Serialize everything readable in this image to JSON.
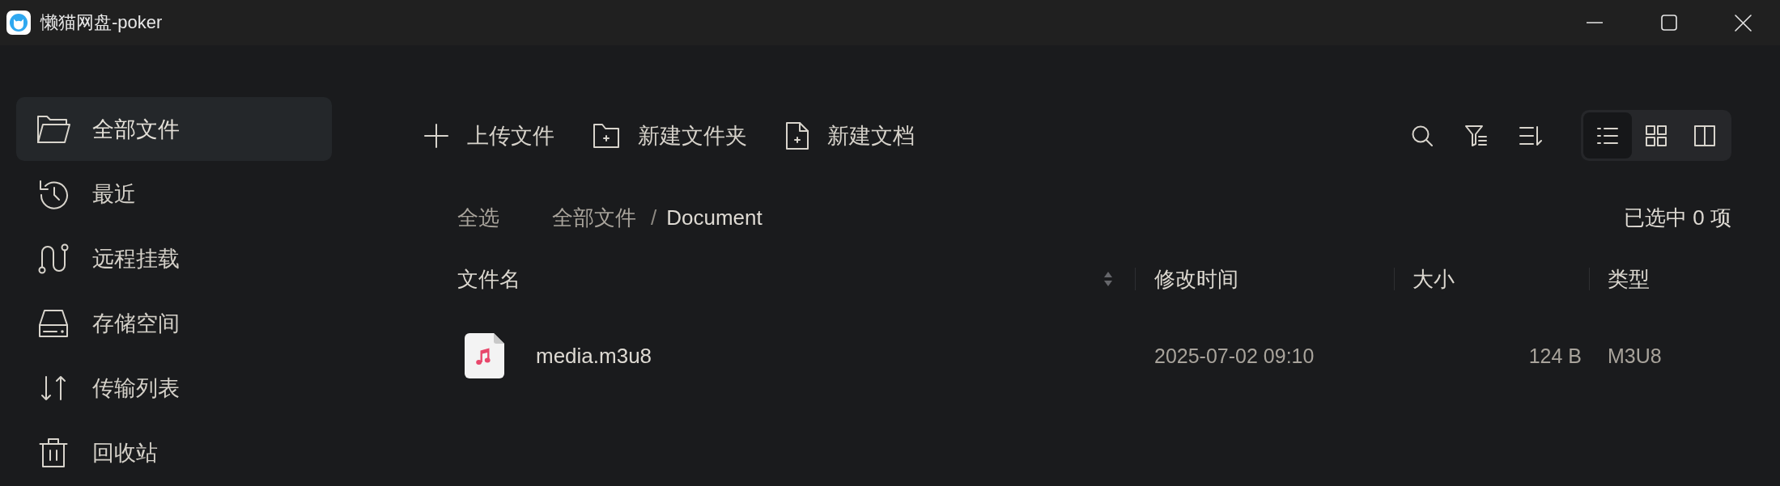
{
  "window": {
    "title": "懒猫网盘-poker"
  },
  "sidebar": {
    "items": [
      {
        "label": "全部文件",
        "selected": true
      },
      {
        "label": "最近",
        "selected": false
      },
      {
        "label": "远程挂载",
        "selected": false
      },
      {
        "label": "存储空间",
        "selected": false
      },
      {
        "label": "传输列表",
        "selected": false
      },
      {
        "label": "回收站",
        "selected": false
      }
    ]
  },
  "toolbar": {
    "actions": [
      {
        "label": "上传文件"
      },
      {
        "label": "新建文件夹"
      },
      {
        "label": "新建文档"
      }
    ],
    "view_modes": [
      {
        "selected": true
      },
      {
        "selected": false
      },
      {
        "selected": false
      }
    ]
  },
  "location_bar": {
    "select_all": "全选",
    "breadcrumb": {
      "items": [
        {
          "label": "全部文件",
          "current": false
        },
        {
          "label": "Document",
          "current": true
        }
      ],
      "separator": "/"
    },
    "selection_count": "已选中 0 项"
  },
  "table": {
    "columns": [
      {
        "label": "文件名",
        "sortable": true
      },
      {
        "label": "修改时间",
        "sortable": false
      },
      {
        "label": "大小",
        "sortable": false
      },
      {
        "label": "类型",
        "sortable": false
      }
    ],
    "rows": [
      {
        "name": "media.m3u8",
        "modified": "2025-07-02 09:10",
        "size": "124 B",
        "type": "M3U8"
      }
    ]
  }
}
